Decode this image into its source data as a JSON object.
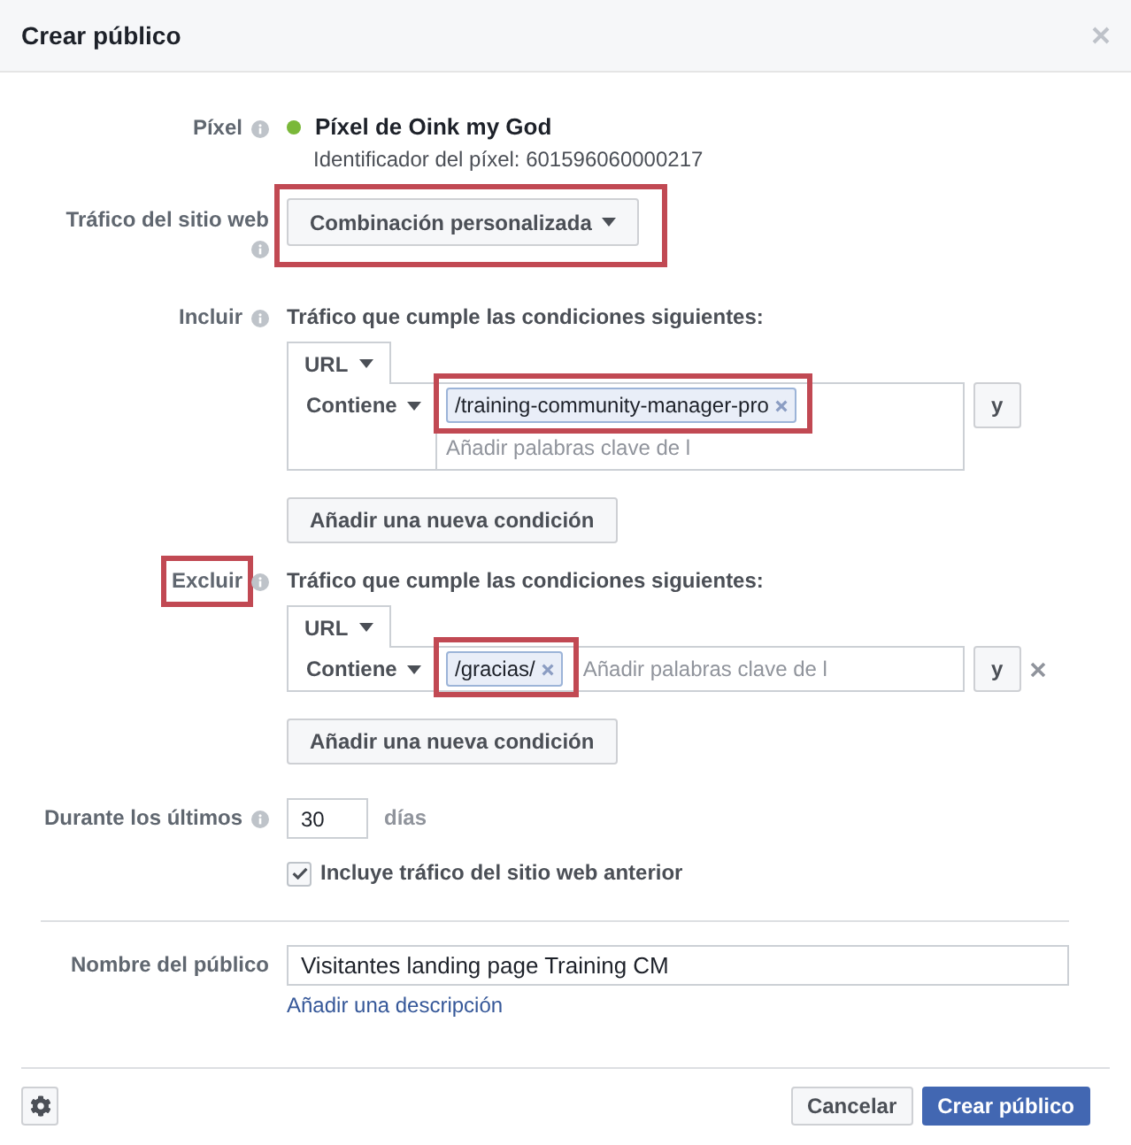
{
  "dialog": {
    "title": "Crear público"
  },
  "pixel": {
    "label": "Píxel",
    "info": true,
    "name": "Píxel de Oink my God",
    "id_text": "Identificador del píxel: 601596060000217"
  },
  "website_traffic": {
    "label": "Tráfico del sitio web",
    "info": true,
    "value": "Combinación personalizada",
    "highlighted": true
  },
  "rule_groups": [
    {
      "label": "Incluir",
      "label_highlighted": false,
      "info": true,
      "heading": "Tráfico que cumple las condiciones siguientes:",
      "conditions": [
        {
          "field": "URL",
          "operator": "Contiene",
          "tags": [
            {
              "text": "/training-community-manager-pro",
              "highlighted": true
            }
          ],
          "placeholder": "Añadir palabras clave de l",
          "connector": "y",
          "removable": false
        }
      ],
      "add_button": "Añadir una nueva condición"
    },
    {
      "label": "Excluir",
      "label_highlighted": true,
      "info": true,
      "heading": "Tráfico que cumple las condiciones siguientes:",
      "conditions": [
        {
          "field": "URL",
          "operator": "Contiene",
          "tags": [
            {
              "text": "/gracias/",
              "highlighted": true
            }
          ],
          "placeholder": "Añadir palabras clave de l",
          "connector": "y",
          "removable": true
        }
      ],
      "add_button": "Añadir una nueva condición"
    }
  ],
  "lookback": {
    "label": "Durante los últimos",
    "info": true,
    "value": "30",
    "unit": "días"
  },
  "include_past": {
    "label": "Incluye tráfico del sitio web anterior",
    "checked": true
  },
  "audience_name": {
    "label": "Nombre del público",
    "info": false,
    "value": "Visitantes landing page Training CM",
    "link": "Añadir una descripción"
  },
  "footer": {
    "buttons": [
      {
        "label": "Cancelar",
        "kind": "secondary"
      },
      {
        "label": "Crear público",
        "kind": "primary"
      }
    ]
  }
}
